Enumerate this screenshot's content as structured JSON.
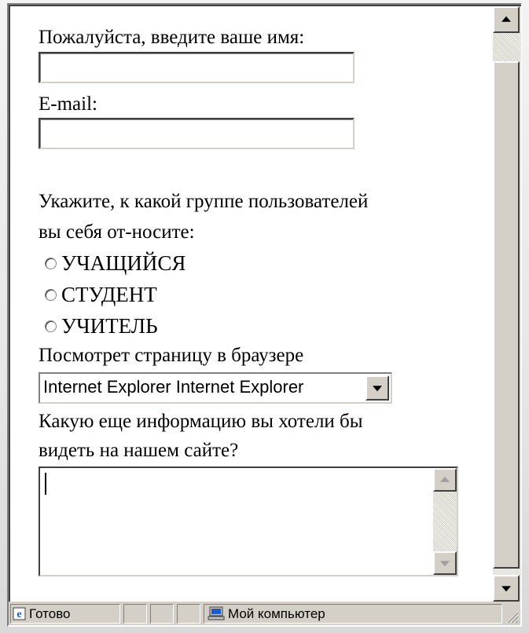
{
  "form": {
    "name_label": "Пожалуйста, введите ваше имя:",
    "name_value": "",
    "email_label": "E-mail:",
    "email_value": "",
    "group_question_line1": "Укажите, к какой группе пользователей",
    "group_question_line2": "вы себя от-носите:",
    "radio_options": [
      {
        "label": "УЧАЩИЙСЯ",
        "checked": false
      },
      {
        "label": "СТУДЕНТ",
        "checked": false
      },
      {
        "label": "УЧИТЕЛЬ",
        "checked": false
      }
    ],
    "browser_label": "Посмотрет страницу в браузере",
    "browser_select_value": "Internet Explorer Internet Explorer",
    "info_question_line1": "Какую еще информацию вы хотели бы",
    "info_question_line2": "видеть на нашем сайте?",
    "info_value": ""
  },
  "statusbar": {
    "status_text": "Готово",
    "zone_text": "Мой компьютер"
  },
  "icons": {
    "status": "ie-page-icon",
    "zone": "my-computer-icon"
  }
}
